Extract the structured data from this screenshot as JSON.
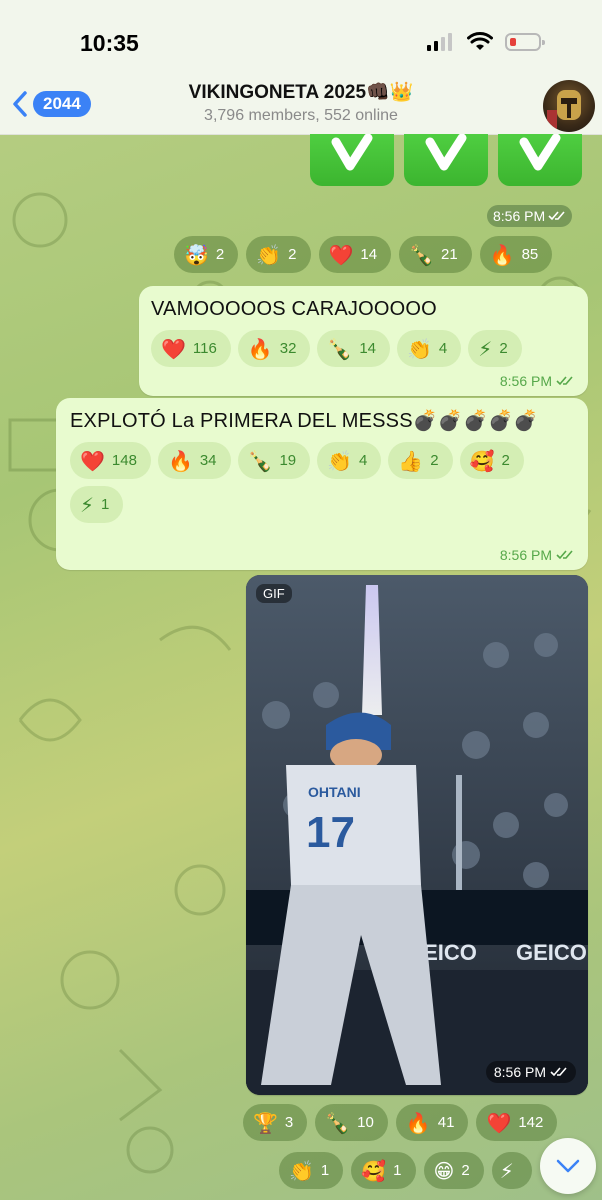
{
  "status_bar": {
    "time": "10:35"
  },
  "header": {
    "back_count": "2044",
    "title": "VIKINGONETA 2025👊🏿👑",
    "subtitle": "3,796 members, 552 online"
  },
  "messages": [
    {
      "type": "emoji-tiles",
      "emojis": [
        "✅",
        "✅",
        "✅"
      ],
      "time": "8:56 PM",
      "reactions": [
        {
          "emoji": "🤯",
          "count": "2"
        },
        {
          "emoji": "👏",
          "count": "2"
        },
        {
          "emoji": "❤️",
          "count": "14"
        },
        {
          "emoji": "🍾",
          "count": "21"
        },
        {
          "emoji": "🔥",
          "count": "85"
        }
      ]
    },
    {
      "type": "text",
      "text": "VAMOOOOOS CARAJOOOOO",
      "time": "8:56 PM",
      "reactions": [
        {
          "emoji": "❤️",
          "count": "116"
        },
        {
          "emoji": "🔥",
          "count": "32"
        },
        {
          "emoji": "🍾",
          "count": "14"
        },
        {
          "emoji": "👏",
          "count": "4"
        },
        {
          "emoji": "⚡",
          "count": "2"
        }
      ]
    },
    {
      "type": "text",
      "text": "EXPLOTÓ La PRIMERA DEL MESSS💣💣💣💣💣",
      "time": "8:56 PM",
      "reactions": [
        {
          "emoji": "❤️",
          "count": "148"
        },
        {
          "emoji": "🔥",
          "count": "34"
        },
        {
          "emoji": "🍾",
          "count": "19"
        },
        {
          "emoji": "👏",
          "count": "4"
        },
        {
          "emoji": "👍",
          "count": "2"
        },
        {
          "emoji": "🥰",
          "count": "2"
        },
        {
          "emoji": "⚡",
          "count": "1"
        }
      ]
    },
    {
      "type": "gif",
      "badge": "GIF",
      "jersey_name": "OHTANI",
      "jersey_number": "17",
      "ad_text": "GEICO",
      "time": "8:56 PM",
      "reactions": [
        {
          "emoji": "🏆",
          "count": "3"
        },
        {
          "emoji": "🍾",
          "count": "10"
        },
        {
          "emoji": "🔥",
          "count": "41"
        },
        {
          "emoji": "❤️",
          "count": "142"
        },
        {
          "emoji": "👏",
          "count": "1"
        },
        {
          "emoji": "🥰",
          "count": "1"
        },
        {
          "emoji": "😁",
          "count": "2"
        },
        {
          "emoji": "⚡",
          "count": ""
        }
      ]
    }
  ],
  "colors": {
    "accent": "#3b82f6",
    "bubble": "#e8fbcf",
    "check_green": "#3cb52f",
    "meta_green": "#56a84a"
  }
}
